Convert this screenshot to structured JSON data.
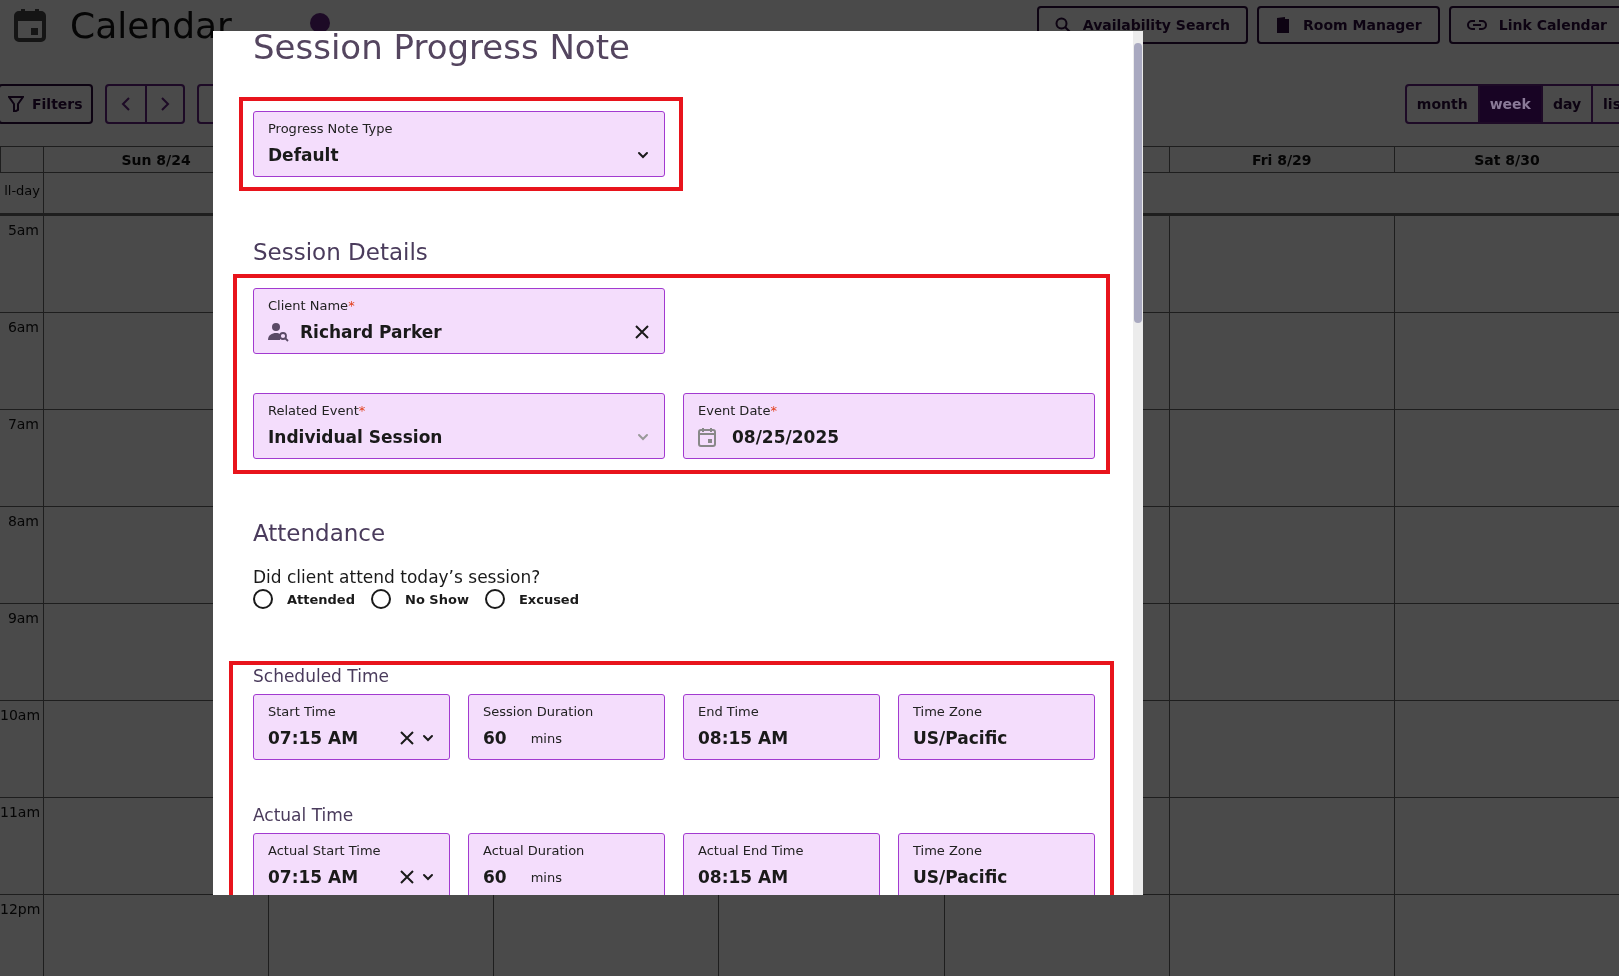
{
  "app": {
    "title": "Calendar",
    "header_buttons": [
      {
        "label": "Availability Search"
      },
      {
        "label": "Room Manager"
      },
      {
        "label": "Link Calendar"
      }
    ]
  },
  "toolbar": {
    "filters": "Filters",
    "views": [
      {
        "label": "month",
        "selected": false
      },
      {
        "label": "week",
        "selected": true
      },
      {
        "label": "day",
        "selected": false
      },
      {
        "label": "lis",
        "selected": false
      }
    ]
  },
  "calendar": {
    "days": [
      "Sun 8/24",
      "Fri 8/29",
      "Sat 8/30"
    ],
    "all_day_label": "ll-day",
    "hours": [
      "5am",
      "6am",
      "7am",
      "8am",
      "9am",
      "10am",
      "11am",
      "12pm"
    ]
  },
  "modal": {
    "title": "Session Progress Note",
    "note_type": {
      "kind": "select",
      "label": "Progress Note Type",
      "value": "Default",
      "caret_dimmed": false
    },
    "session_details": {
      "heading": "Session Details",
      "client": {
        "kind": "client",
        "label": "Client Name",
        "required_mark": "*",
        "value": "Richard Parker"
      },
      "related_event": {
        "kind": "select",
        "label": "Related Event",
        "required_mark": "*",
        "value": "Individual Session",
        "caret_dimmed": true
      },
      "event_date": {
        "kind": "date",
        "label": "Event Date",
        "required_mark": "*",
        "value": "08/25/2025"
      }
    },
    "attendance": {
      "heading": "Attendance",
      "question": "Did client attend today’s session?",
      "options": [
        {
          "label": "Attended",
          "selected": false
        },
        {
          "label": "No Show",
          "selected": false
        },
        {
          "label": "Excused",
          "selected": false
        }
      ]
    },
    "scheduled_time": {
      "heading": "Scheduled Time",
      "fields": [
        {
          "kind": "time",
          "label": "Start Time",
          "value": "07:15 AM"
        },
        {
          "kind": "duration",
          "label": "Session Duration",
          "value": "60",
          "unit": "mins"
        },
        {
          "kind": "text",
          "label": "End Time",
          "value": "08:15 AM"
        },
        {
          "kind": "text",
          "label": "Time Zone",
          "value": "US/Pacific"
        }
      ]
    },
    "actual_time": {
      "heading": "Actual Time",
      "fields": [
        {
          "kind": "time",
          "label": "Actual Start Time",
          "value": "07:15 AM"
        },
        {
          "kind": "duration",
          "label": "Actual Duration",
          "value": "60",
          "unit": "mins"
        },
        {
          "kind": "text",
          "label": "Actual End Time",
          "value": "08:15 AM"
        },
        {
          "kind": "text",
          "label": "Time Zone",
          "value": "US/Pacific"
        }
      ]
    }
  }
}
